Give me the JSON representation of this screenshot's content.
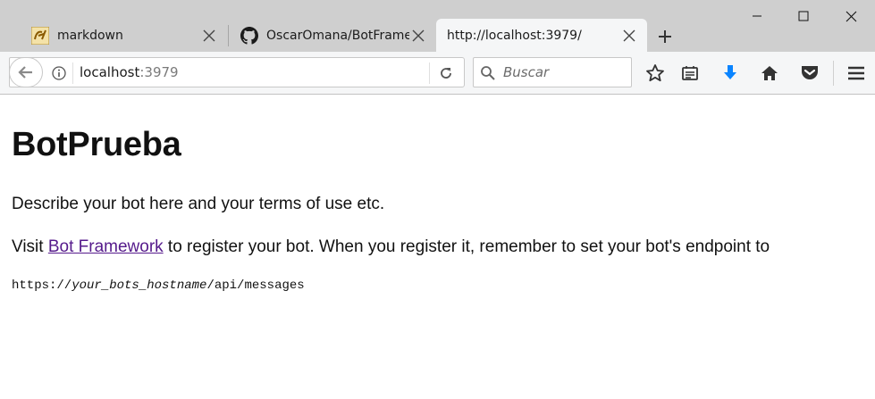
{
  "tabs": [
    {
      "title": "markdown",
      "favicon": "markdown-favicon",
      "active": false
    },
    {
      "title": "OscarOmana/BotFrame",
      "favicon": "github-icon",
      "active": false
    },
    {
      "title": "http://localhost:3979/",
      "favicon": "",
      "active": true
    }
  ],
  "urlbar": {
    "host": "localhost",
    "port": ":3979"
  },
  "search": {
    "placeholder": "Buscar"
  },
  "colors": {
    "download_arrow": "#0a84ff",
    "link_visited": "#551a8b"
  },
  "page": {
    "title": "BotPrueba",
    "description": "Describe your bot here and your terms of use etc.",
    "visit_prefix": "Visit ",
    "link_text": "Bot Framework",
    "visit_suffix": " to register your bot. When you register it, remember to set your bot's endpoint to",
    "endpoint_prefix": "https://",
    "endpoint_host": "your_bots_hostname",
    "endpoint_suffix": "/api/messages"
  }
}
